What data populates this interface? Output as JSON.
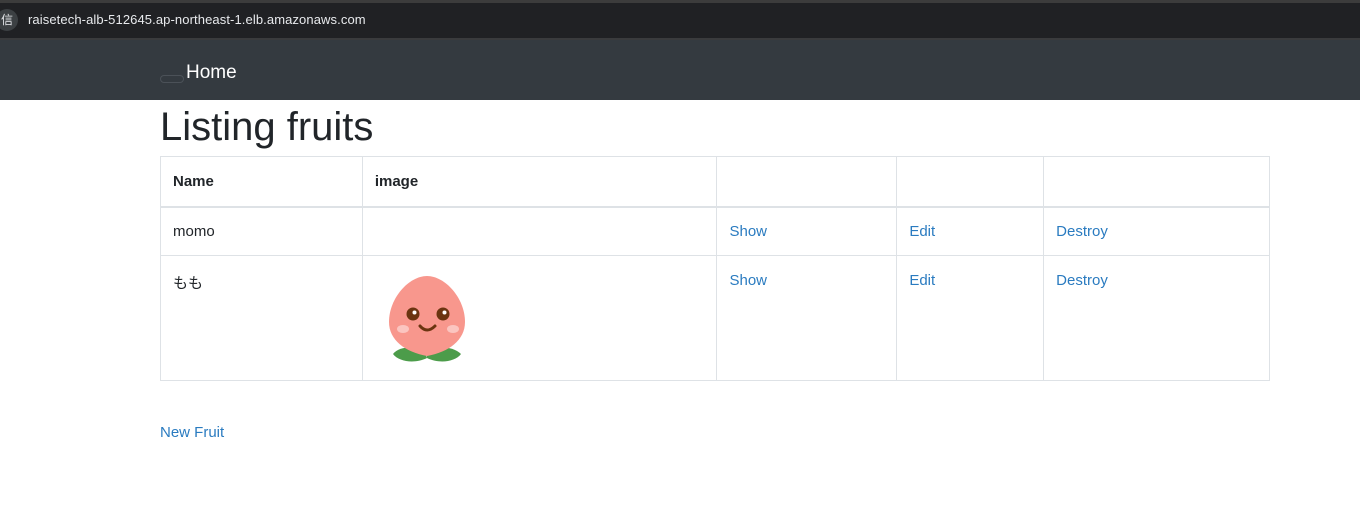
{
  "browser": {
    "site_badge": "信",
    "url": "raisetech-alb-512645.ap-northeast-1.elb.amazonaws.com"
  },
  "navbar": {
    "brand": "Home"
  },
  "page": {
    "title": "Listing fruits"
  },
  "table": {
    "headers": [
      "Name",
      "image",
      "",
      "",
      ""
    ],
    "rows": [
      {
        "name": "momo",
        "has_image": false,
        "show": "Show",
        "edit": "Edit",
        "destroy": "Destroy"
      },
      {
        "name": "もも",
        "has_image": true,
        "image_icon": "peach-icon",
        "show": "Show",
        "edit": "Edit",
        "destroy": "Destroy"
      }
    ]
  },
  "new_link": "New Fruit",
  "colors": {
    "navbar": "#343a40",
    "link": "#2a7bc0",
    "peach": "#f8978d",
    "leaf": "#4c9c4a"
  }
}
